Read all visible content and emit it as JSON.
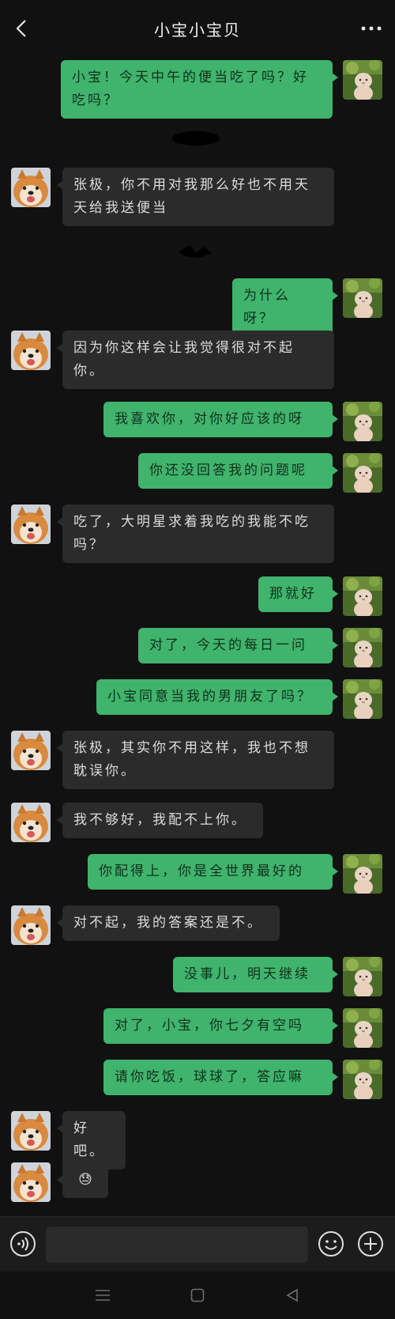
{
  "header": {
    "title": "小宝小宝贝",
    "back_icon": "chevron-left-icon",
    "more_icon": "more-dots-icon"
  },
  "messages": [
    {
      "sender": "me",
      "text": "小宝！今天中午的便当吃了吗？好吃吗？"
    },
    {
      "sender": "them",
      "text": "张极，你不用对我那么好也不用天天给我送便当"
    },
    {
      "sender": "me",
      "text": "为什么呀？"
    },
    {
      "sender": "them",
      "text": "因为你这样会让我觉得很对不起你。"
    },
    {
      "sender": "me",
      "text": "我喜欢你，对你好应该的呀"
    },
    {
      "sender": "me",
      "text": "你还没回答我的问题呢"
    },
    {
      "sender": "them",
      "text": "吃了，大明星求着我吃的我能不吃吗？"
    },
    {
      "sender": "me",
      "text": "那就好"
    },
    {
      "sender": "me",
      "text": "对了，今天的每日一问"
    },
    {
      "sender": "me",
      "text": "小宝同意当我的男朋友了吗？"
    },
    {
      "sender": "them",
      "text": "张极，其实你不用这样，我也不想耽误你。"
    },
    {
      "sender": "them",
      "text": "我不够好，我配不上你。"
    },
    {
      "sender": "me",
      "text": "你配得上，你是全世界最好的"
    },
    {
      "sender": "them",
      "text": "对不起，我的答案还是不。"
    },
    {
      "sender": "me",
      "text": "没事儿，明天继续"
    },
    {
      "sender": "me",
      "text": "对了，小宝，你七夕有空吗"
    },
    {
      "sender": "me",
      "text": "请你吃饭，球球了，答应嘛"
    },
    {
      "sender": "them",
      "text": "好吧。"
    },
    {
      "sender": "them",
      "text": "😓"
    }
  ],
  "input": {
    "placeholder": "",
    "voice_icon": "voice-icon",
    "emoji_icon": "emoji-icon",
    "plus_icon": "plus-icon"
  },
  "colors": {
    "background": "#111111",
    "my_bubble": "#40b36c",
    "their_bubble": "#2b2b2b"
  }
}
